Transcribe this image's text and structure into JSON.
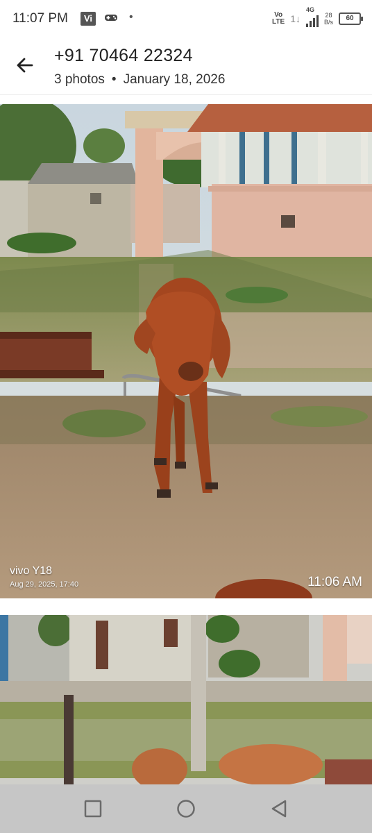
{
  "status_bar": {
    "time": "11:07 PM",
    "vi_badge": "Vi",
    "dot": "•",
    "volte": "Vo\nLTE",
    "network": "4G",
    "speed": "28\nB/s",
    "battery": "60"
  },
  "header": {
    "title": "+91 70464 22324",
    "photo_count": "3 photos",
    "separator": "•",
    "date": "January 18, 2026"
  },
  "photos": [
    {
      "watermark_brand": "vivo Y18",
      "watermark_date": "Aug 29, 2025, 17:40",
      "timestamp": "11:06 AM"
    },
    {}
  ],
  "navigation": {
    "recent_icon": "square-icon",
    "home_icon": "circle-icon",
    "back_icon": "triangle-icon"
  }
}
